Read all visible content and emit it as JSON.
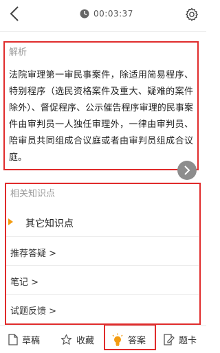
{
  "header": {
    "timer": "00:03:37"
  },
  "analysis": {
    "title": "解析",
    "body": "法院审理第一审民事案件，除适用简易程序、特别程序（选民资格案件及重大、疑难的案件除外）、督促程序、公示催告程序审理的民事案件由审判员一人独任审理外，一律由审判员、陪审员共同组成合议庭或者由审判员组成合议庭。"
  },
  "related": {
    "title": "相关知识点",
    "knowledge_point": "其它知识点",
    "items": [
      {
        "label": "推荐答疑 >"
      },
      {
        "label": "笔记 >"
      },
      {
        "label": "试题反馈 >"
      }
    ]
  },
  "bottom_tabs": [
    {
      "label": "草稿",
      "icon": "draft-icon"
    },
    {
      "label": "收藏",
      "icon": "star-icon"
    },
    {
      "label": "答案",
      "icon": "lightbulb-icon"
    },
    {
      "label": "题卡",
      "icon": "answer-card-icon"
    }
  ],
  "colors": {
    "highlight_border": "#e02b2b",
    "accent_orange": "#f39c12",
    "arrow_button_bg": "#8d8d8d"
  }
}
